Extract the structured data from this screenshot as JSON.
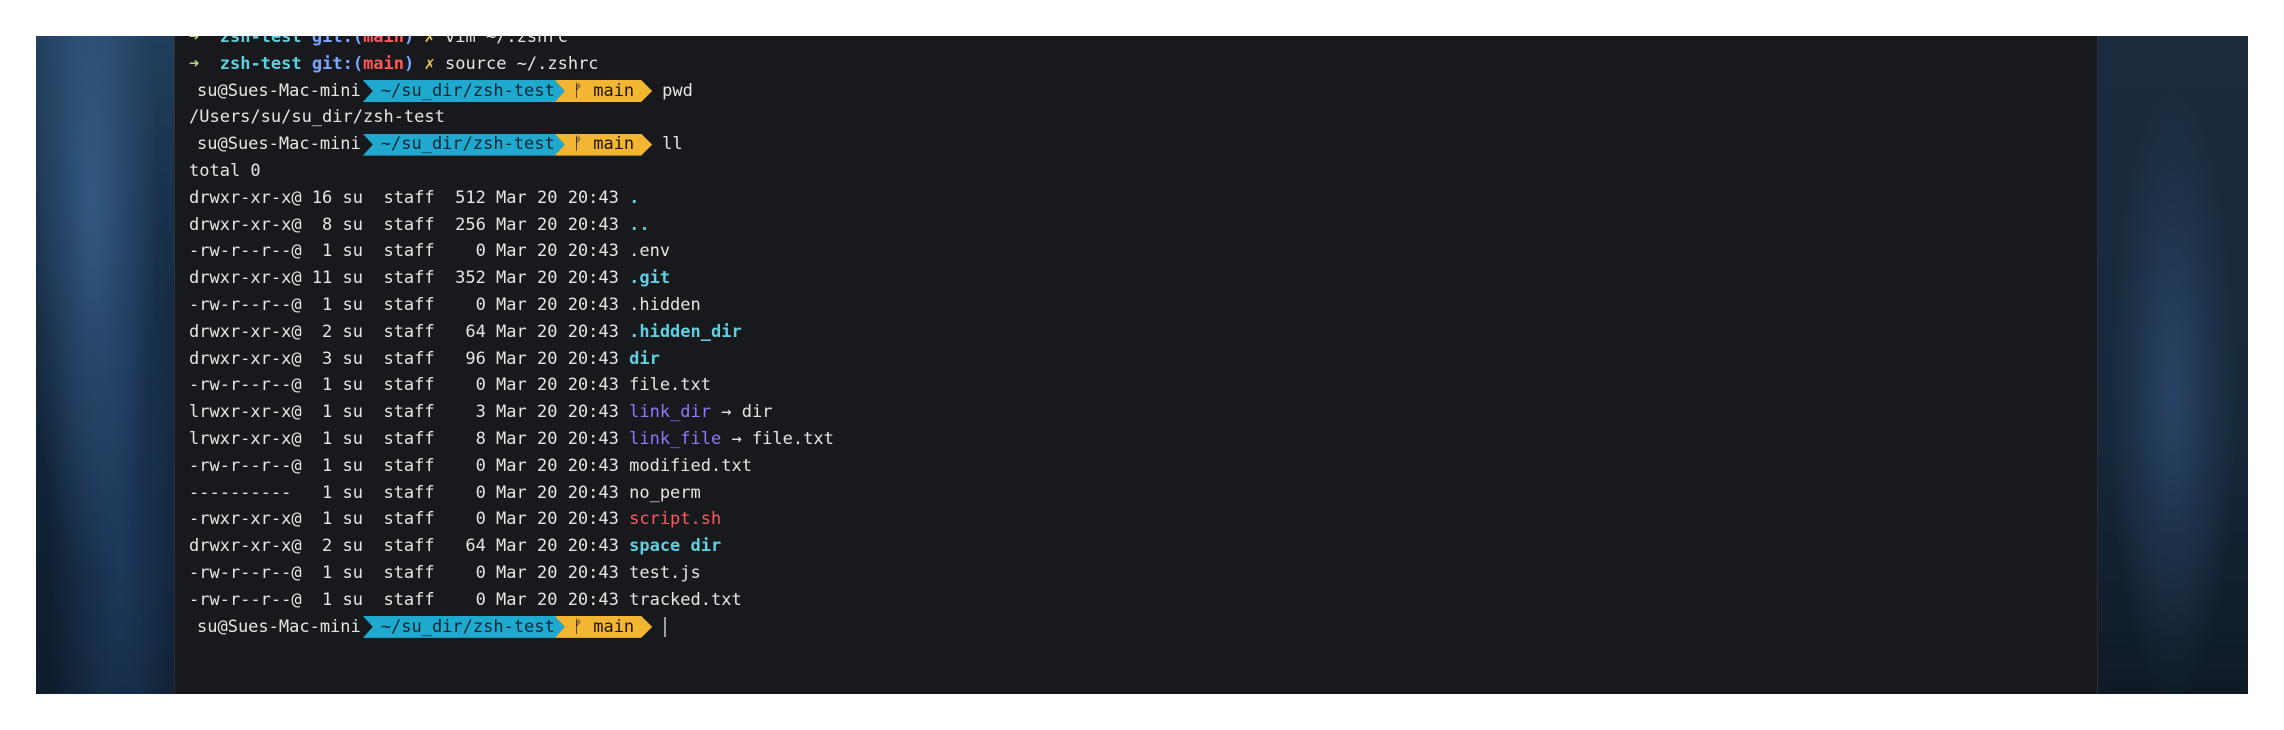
{
  "prev_prompts": [
    {
      "arrow": "➜",
      "dir": "zsh-test",
      "git_label": "git:(",
      "branch": "main",
      "git_close": ")",
      "dirty": "✗",
      "cmd": "vim ~/.zshrc"
    },
    {
      "arrow": "➜",
      "dir": "zsh-test",
      "git_label": "git:(",
      "branch": "main",
      "git_close": ")",
      "dirty": "✗",
      "cmd": "source ~/.zshrc"
    }
  ],
  "prompt": {
    "user": "su@Sues-Mac-mini",
    "dir": "~/su_dir/zsh-test",
    "branch_icon": "ᚠ",
    "branch": "main"
  },
  "commands": [
    "pwd",
    "ll"
  ],
  "pwd_output": "/Users/su/su_dir/zsh-test",
  "ls_total": "total 0",
  "ls_rows": [
    {
      "meta": "drwxr-xr-x@ 16 su  staff  512 Mar 20 20:43 ",
      "name": ".",
      "type": "dir"
    },
    {
      "meta": "drwxr-xr-x@  8 su  staff  256 Mar 20 20:43 ",
      "name": "..",
      "type": "dir"
    },
    {
      "meta": "-rw-r--r--@  1 su  staff    0 Mar 20 20:43 ",
      "name": ".env",
      "type": "file"
    },
    {
      "meta": "drwxr-xr-x@ 11 su  staff  352 Mar 20 20:43 ",
      "name": ".git",
      "type": "dir"
    },
    {
      "meta": "-rw-r--r--@  1 su  staff    0 Mar 20 20:43 ",
      "name": ".hidden",
      "type": "file"
    },
    {
      "meta": "drwxr-xr-x@  2 su  staff   64 Mar 20 20:43 ",
      "name": ".hidden_dir",
      "type": "dir"
    },
    {
      "meta": "drwxr-xr-x@  3 su  staff   96 Mar 20 20:43 ",
      "name": "dir",
      "type": "dir"
    },
    {
      "meta": "-rw-r--r--@  1 su  staff    0 Mar 20 20:43 ",
      "name": "file.txt",
      "type": "file"
    },
    {
      "meta": "lrwxr-xr-x@  1 su  staff    3 Mar 20 20:43 ",
      "name": "link_dir",
      "type": "link",
      "target": " → dir"
    },
    {
      "meta": "lrwxr-xr-x@  1 su  staff    8 Mar 20 20:43 ",
      "name": "link_file",
      "type": "link",
      "target": " → file.txt"
    },
    {
      "meta": "-rw-r--r--@  1 su  staff    0 Mar 20 20:43 ",
      "name": "modified.txt",
      "type": "file"
    },
    {
      "meta": "----------   1 su  staff    0 Mar 20 20:43 ",
      "name": "no_perm",
      "type": "file"
    },
    {
      "meta": "-rwxr-xr-x@  1 su  staff    0 Mar 20 20:43 ",
      "name": "script.sh",
      "type": "exec"
    },
    {
      "meta": "drwxr-xr-x@  2 su  staff   64 Mar 20 20:43 ",
      "name": "space dir",
      "type": "dir"
    },
    {
      "meta": "-rw-r--r--@  1 su  staff    0 Mar 20 20:43 ",
      "name": "test.js",
      "type": "file"
    },
    {
      "meta": "-rw-r--r--@  1 su  staff    0 Mar 20 20:43 ",
      "name": "tracked.txt",
      "type": "file"
    }
  ],
  "colors": {
    "dir": "#5fd0e0",
    "link": "#8b7bff",
    "exec": "#ff5a5a",
    "prompt_dir_bg": "#1fa9cf",
    "prompt_git_bg": "#f2b632",
    "terminal_bg": "#17191d"
  }
}
